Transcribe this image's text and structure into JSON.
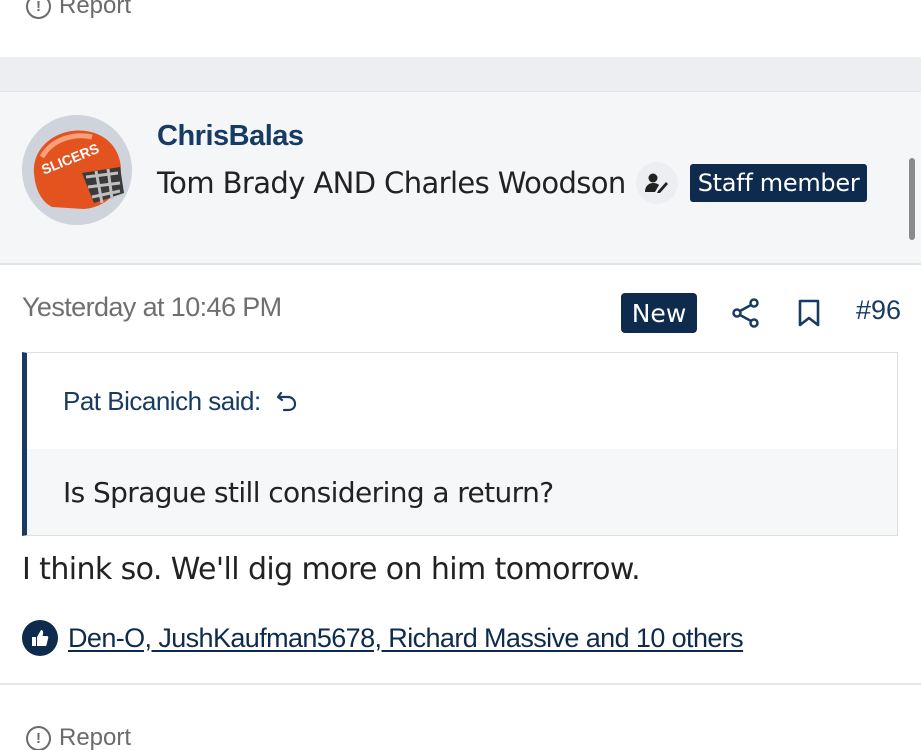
{
  "previous_post": {
    "report_label": "Report"
  },
  "post": {
    "user": {
      "name": "ChrisBalas",
      "title": "Tom Brady AND Charles Woodson",
      "staff_badge": "Staff member",
      "avatar_text": "SLICERS"
    },
    "meta": {
      "timestamp": "Yesterday at 10:46 PM",
      "new_badge": "New",
      "post_number": "#96"
    },
    "quote": {
      "author": "Pat Bicanich said:",
      "text": "Is Sprague still considering a return?"
    },
    "body": "I think so. We'll dig more on him tomorrow.",
    "reactions": "Den-O, JushKaufman5678, Richard Massive and 10 others",
    "report_label": "Report"
  },
  "colors": {
    "navy": "#0e2a4d",
    "link_blue": "#183b63",
    "helmet_orange": "#e2531f"
  },
  "icons": [
    "info-circle-icon",
    "user-pen-icon",
    "share-icon",
    "bookmark-icon",
    "reply-arrow-icon",
    "thumbs-up-icon"
  ]
}
